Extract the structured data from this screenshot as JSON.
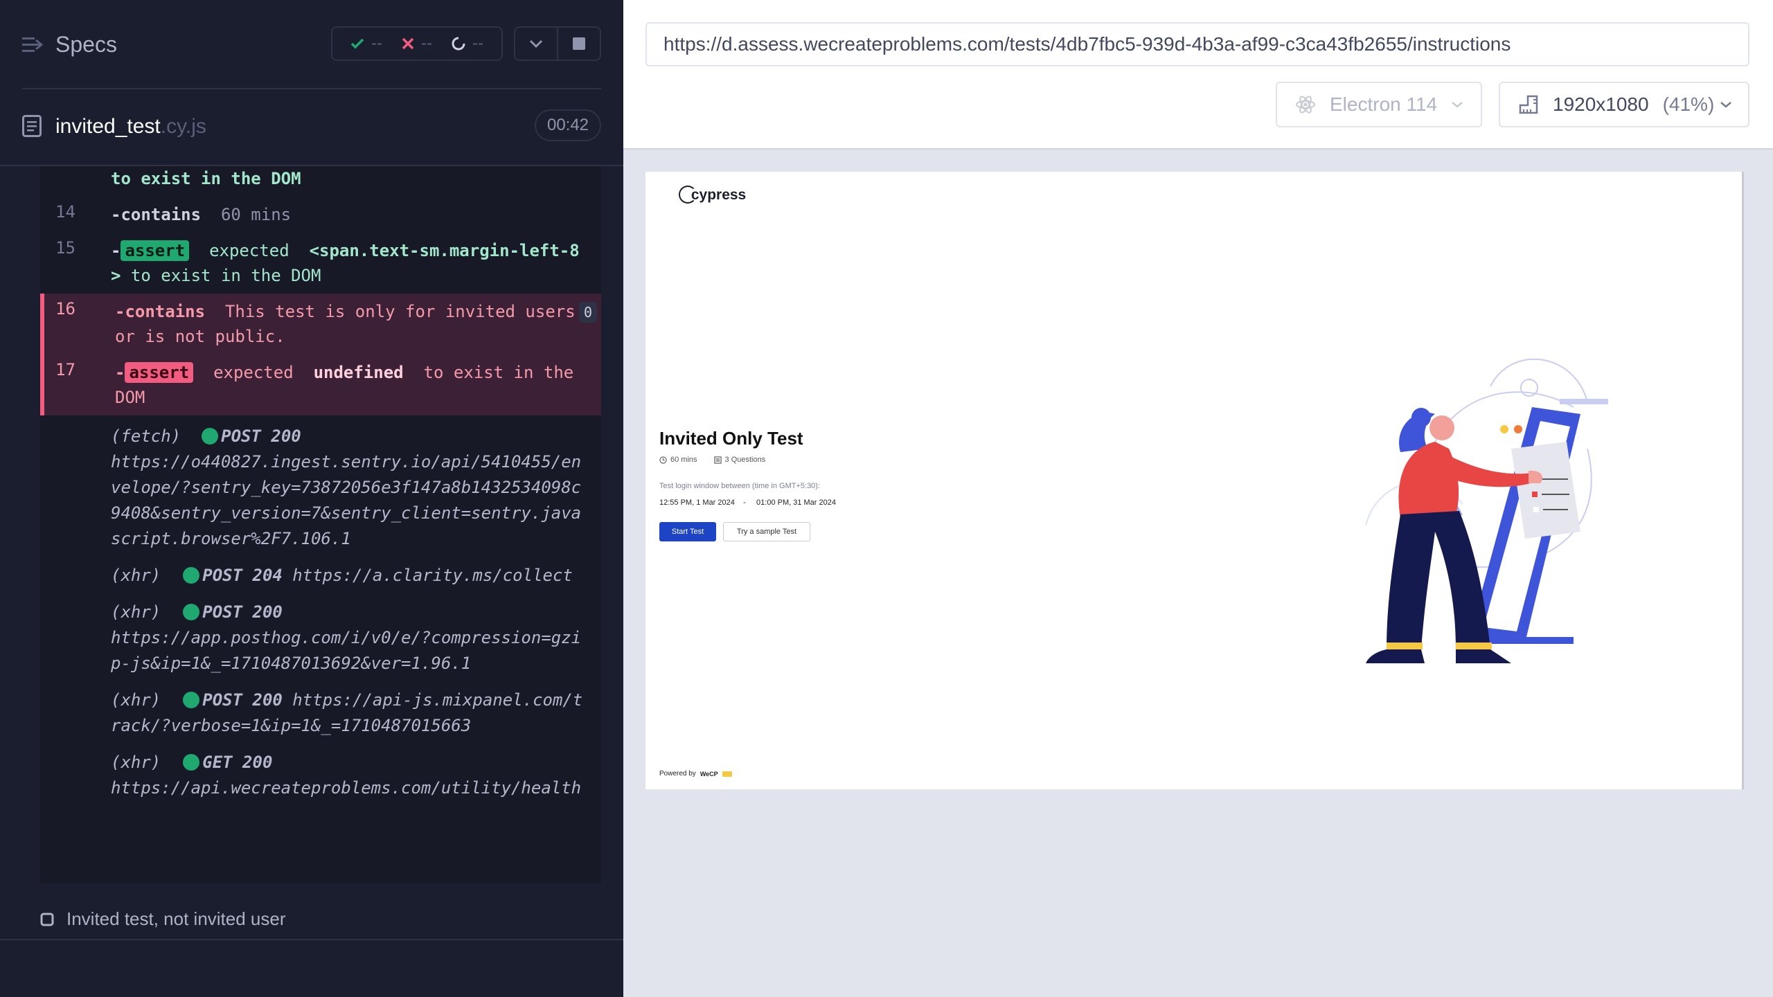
{
  "reporter": {
    "specs_label": "Specs",
    "stats": {
      "passed": "--",
      "failed": "--",
      "pending": "--"
    },
    "spec_file": {
      "name": "invited_test",
      "ext": ".cy.js",
      "duration": "00:42"
    },
    "commands": [
      {
        "num": "",
        "type": "passed-continuation",
        "text": "to exist in the DOM"
      },
      {
        "num": "14",
        "name": "contains",
        "msg": "60 mins"
      },
      {
        "num": "15",
        "badge": "assert",
        "msg_pre": "expected",
        "msg_bold": "<span.text-sm.margin-left-8>",
        "msg_post": "to exist in the DOM"
      },
      {
        "num": "16",
        "name": "contains",
        "msg": "This test is only for invited users or is not public.",
        "count": "0"
      },
      {
        "num": "17",
        "badge": "assert",
        "msg_pre": "expected",
        "msg_bold": "undefined",
        "msg_post": "to exist in the DOM"
      }
    ],
    "network": [
      {
        "kind": "(fetch)",
        "method": "POST 200",
        "url": "https://o440827.ingest.sentry.io/api/5410455/envelope/?sentry_key=73872056e3f147a8b1432534098c9408&sentry_version=7&sentry_client=sentry.javascript.browser%2F7.106.1"
      },
      {
        "kind": "(xhr)",
        "method": "POST 204",
        "url": "https://a.clarity.ms/collect"
      },
      {
        "kind": "(xhr)",
        "method": "POST 200",
        "url": "https://app.posthog.com/i/v0/e/?compression=gzip-js&ip=1&_=1710487013692&ver=1.96.1"
      },
      {
        "kind": "(xhr)",
        "method": "POST 200",
        "url": "https://api-js.mixpanel.com/track/?verbose=1&ip=1&_=1710487015663"
      },
      {
        "kind": "(xhr)",
        "method": "GET 200",
        "url": "https://api.wecreateproblems.com/utility/health"
      }
    ],
    "test_title": "Invited test, not invited user"
  },
  "aut": {
    "url": "https://d.assess.wecreateproblems.com/tests/4db7fbc5-939d-4b3a-af99-c3ca43fb2655/instructions",
    "browser": "Electron 114",
    "viewport": "1920x1080",
    "scale": "(41%)",
    "page": {
      "logo": "cypress",
      "heading": "Invited Only Test",
      "duration": "60 mins",
      "questions": "3 Questions",
      "login_label": "Test login window between (time in GMT+5:30):",
      "login_start": "12:55 PM, 1 Mar 2024",
      "login_sep": "-",
      "login_end": "01:00 PM, 31 Mar 2024",
      "start_button": "Start Test",
      "sample_button": "Try a sample Test",
      "powered_by": "Powered by",
      "powered_brand": "WeCP"
    }
  },
  "colors": {
    "reporter_bg": "#1b1e2e",
    "pass": "#1fa971",
    "fail": "#f15c80",
    "primary_button": "#1e44c6"
  }
}
